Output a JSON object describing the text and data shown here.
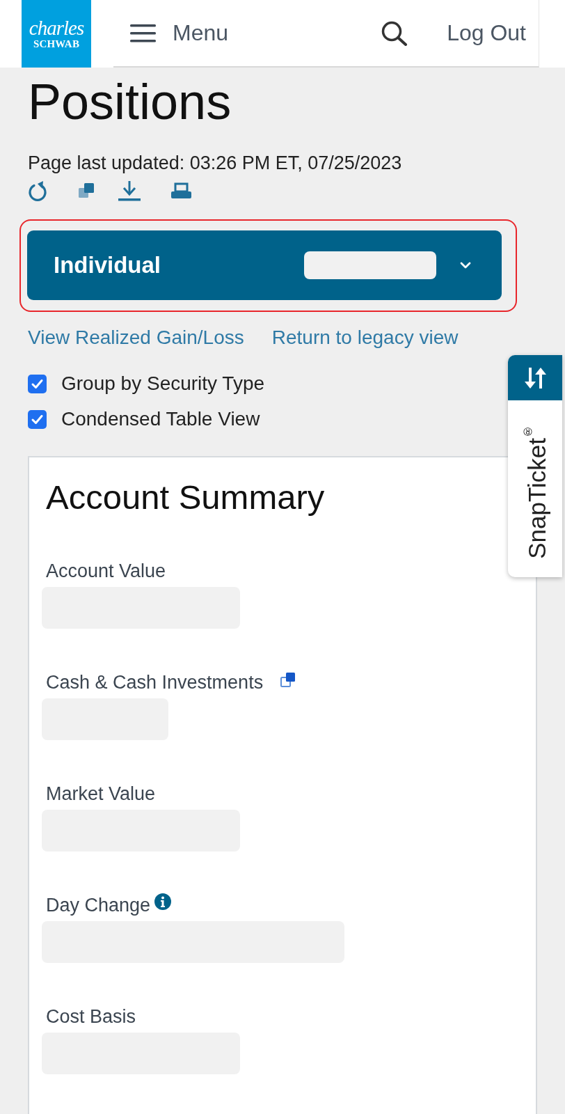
{
  "header": {
    "logo": {
      "line_1": "charles",
      "line_2": "SCHWAB"
    },
    "menu_label": "Menu",
    "log_out": "Log Out"
  },
  "page": {
    "title": "Positions",
    "last_updated": "Page last updated: 03:26 PM ET, 07/25/2023"
  },
  "account_selector": {
    "label": "Individual",
    "number_redacted": true,
    "highlighted": true
  },
  "links": [
    "View Realized Gain/Loss",
    "Return to legacy view"
  ],
  "options": [
    {
      "label": "Group by Security Type",
      "checked": true
    },
    {
      "label": "Condensed Table View",
      "checked": true
    }
  ],
  "side_tab": {
    "label": "SnapTicket$^{®}$"
  },
  "account_summary": {
    "title": "Account Summary",
    "fields": [
      {
        "label": "Account Value",
        "kind": "plain",
        "value_redacted": true
      },
      {
        "label": "Cash & Cash Investments",
        "kind": "popup",
        "value_redacted": true
      },
      {
        "label": "Market Value",
        "kind": "plain",
        "value_redacted": true
      },
      {
        "label": "Day Change",
        "kind": "info",
        "value_redacted": true
      },
      {
        "label": "Cost Basis",
        "kind": "plain",
        "value_redacted": true
      }
    ]
  }
}
